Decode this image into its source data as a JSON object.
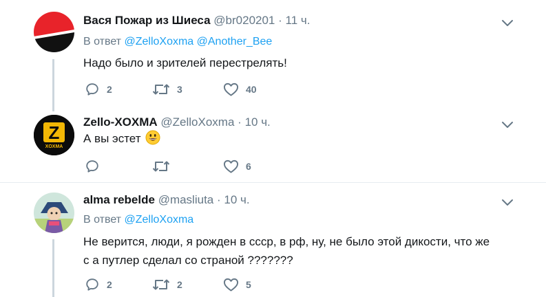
{
  "tweets": [
    {
      "name": "Вася Пожар из Шиеса",
      "handle": "@br020201",
      "separator": "·",
      "time": "11 ч.",
      "reply_prefix": "В ответ",
      "mentions": [
        "@ZelloXoxma",
        "@Another_Bee"
      ],
      "text": "Надо было и зрителей перестрелять!",
      "replies": "2",
      "retweets": "3",
      "likes": "40"
    },
    {
      "name": "Zello-XOXMA",
      "handle": "@ZelloXoxma",
      "separator": "·",
      "time": "10 ч.",
      "text": "А вы эстет",
      "emoji": "smiling-face-emoji",
      "avatar_logo": "Z",
      "avatar_caption": "XOXMA",
      "replies": "",
      "retweets": "",
      "likes": "6"
    },
    {
      "name": "alma rebelde",
      "handle": "@masliuta",
      "separator": "·",
      "time": "10 ч.",
      "reply_prefix": "В ответ",
      "mentions": [
        "@ZelloXoxma"
      ],
      "text_line1": "Не верится, люди, я рожден в ссср, в рф, ну,  не было этой дикости, что же",
      "text_line2": "с  а путлер сделал со страной ???????",
      "replies": "2",
      "retweets": "2",
      "likes": "5"
    }
  ],
  "colors": {
    "text": "#14171a",
    "secondary": "#657786",
    "link": "#1da1f2",
    "thread_line": "#ccd6dd",
    "divider": "#e6ecf0"
  },
  "icons": [
    "reply-icon",
    "retweet-icon",
    "like-icon",
    "chevron-down-icon"
  ]
}
